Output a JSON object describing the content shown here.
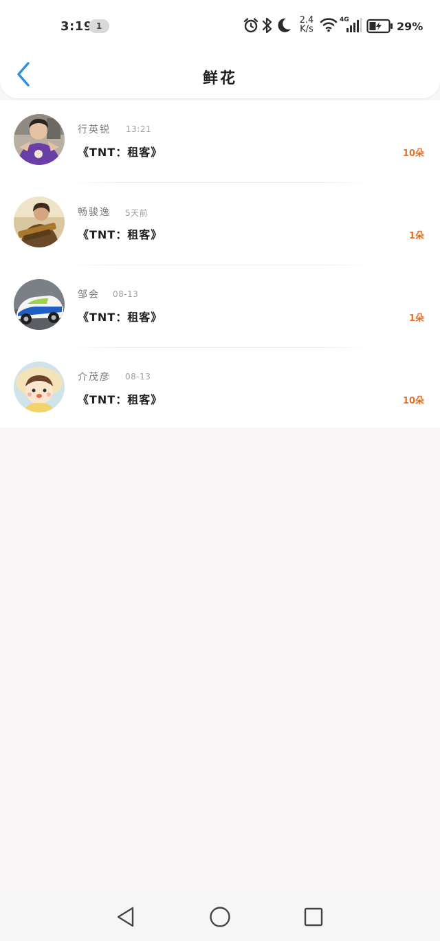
{
  "status_bar": {
    "time": "3:19",
    "notification_count": "1",
    "net_speed_value": "2.4",
    "net_speed_unit": "K/s",
    "network_type": "4G",
    "battery_percent": "29%",
    "icons": [
      "alarm-icon",
      "bluetooth-icon",
      "moon-icon",
      "wifi-icon",
      "cell-signal-icon",
      "battery-charging-icon"
    ]
  },
  "header": {
    "title": "鲜花",
    "back_icon": "chevron-left-icon",
    "accent_color": "#2f8ee0"
  },
  "list": {
    "items": [
      {
        "name": "行英锐",
        "date": "13:21",
        "title": "《TNT：租客》",
        "count": "10朵"
      },
      {
        "name": "畅骏逸",
        "date": "5天前",
        "title": "《TNT：租客》",
        "count": "1朵"
      },
      {
        "name": "邹会",
        "date": "08-13",
        "title": "《TNT：租客》",
        "count": "1朵"
      },
      {
        "name": "介茂彦",
        "date": "08-13",
        "title": "《TNT：租客》",
        "count": "10朵"
      }
    ],
    "count_color": "#e0722b"
  },
  "nav_bar": {
    "icons": [
      "back-triangle-icon",
      "home-circle-icon",
      "recents-square-icon"
    ]
  }
}
